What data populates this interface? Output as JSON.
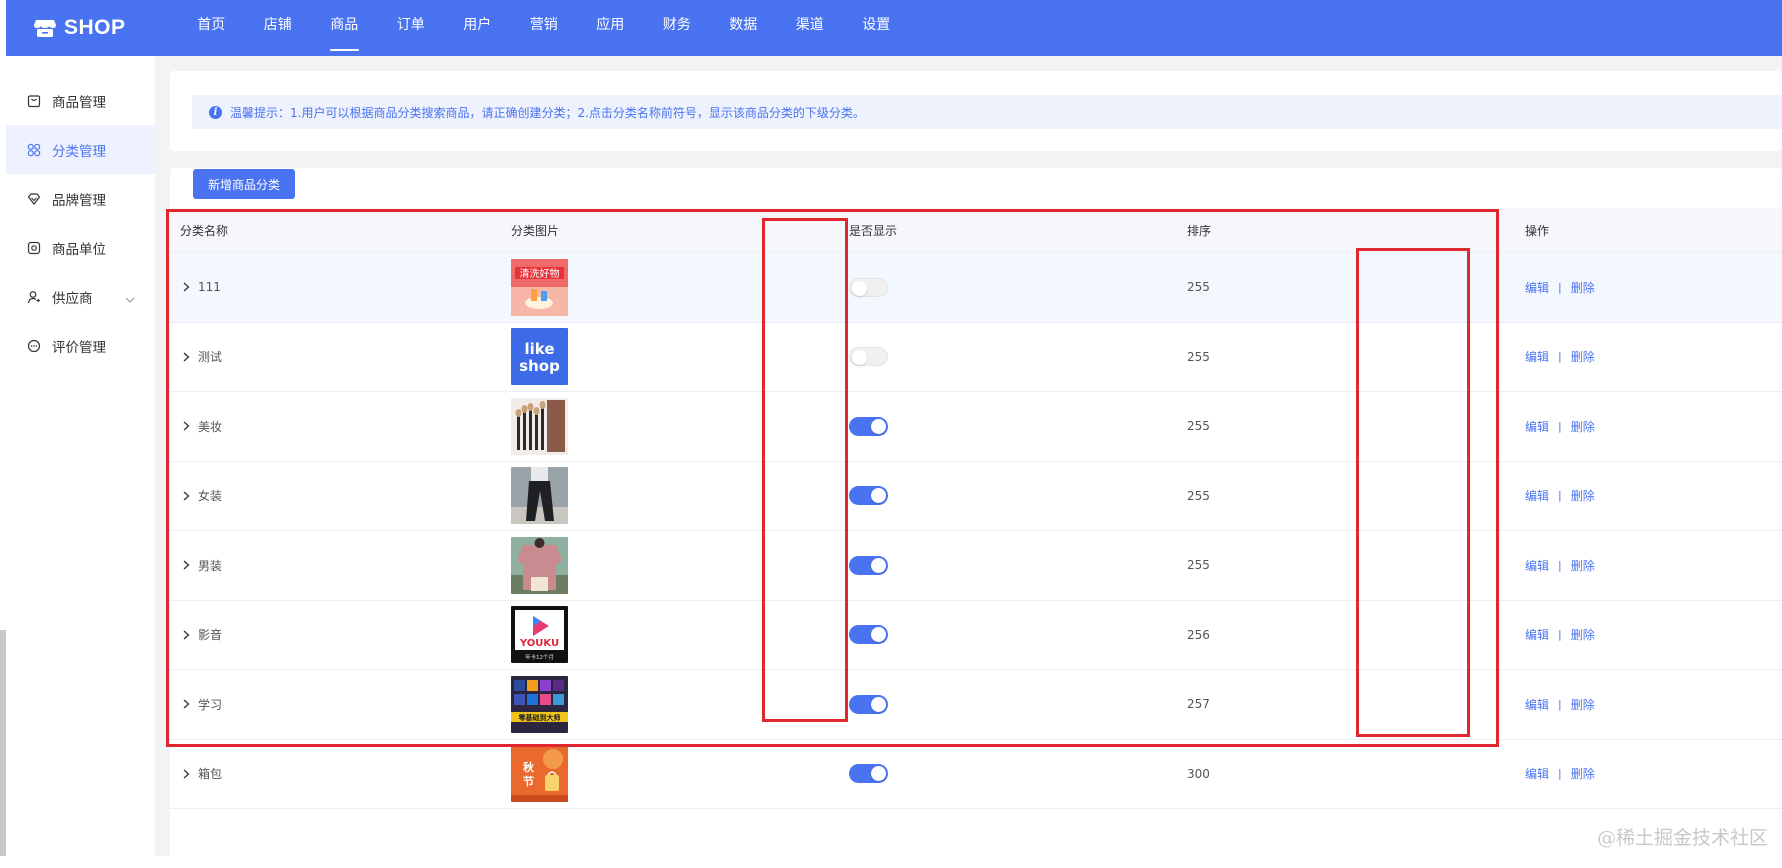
{
  "app": {
    "logo_text": "SHOP"
  },
  "topnav": {
    "items": [
      "首页",
      "店铺",
      "商品",
      "订单",
      "用户",
      "营销",
      "应用",
      "财务",
      "数据",
      "渠道",
      "设置"
    ],
    "active_index": 2
  },
  "sidebar": {
    "items": [
      {
        "label": "商品管理",
        "icon": "bag-icon"
      },
      {
        "label": "分类管理",
        "icon": "category-grid-icon",
        "active": true
      },
      {
        "label": "品牌管理",
        "icon": "diamond-icon"
      },
      {
        "label": "商品单位",
        "icon": "unit-icon"
      },
      {
        "label": "供应商",
        "icon": "supplier-user-icon",
        "expandable": true
      },
      {
        "label": "评价管理",
        "icon": "comment-icon"
      }
    ]
  },
  "tip": {
    "text": "温馨提示：1.用户可以根据商品分类搜索商品，请正确创建分类；2.点击分类名称前符号，显示该商品分类的下级分类。"
  },
  "toolbar": {
    "add_label": "新增商品分类"
  },
  "table": {
    "headers": {
      "name": "分类名称",
      "image": "分类图片",
      "show": "是否显示",
      "sort": "排序",
      "ops": "操作"
    },
    "edit_label": "编辑",
    "delete_label": "删除",
    "separator": "|",
    "rows": [
      {
        "name": "111",
        "image": "thumb-red-promo",
        "show": false,
        "sort": "255"
      },
      {
        "name": "测试",
        "image": "thumb-likeshop-logo",
        "show": false,
        "sort": "255"
      },
      {
        "name": "美妆",
        "image": "thumb-makeup-brushes",
        "show": true,
        "sort": "255"
      },
      {
        "name": "女装",
        "image": "thumb-women-pants",
        "show": true,
        "sort": "255"
      },
      {
        "name": "男装",
        "image": "thumb-men-shirt",
        "show": true,
        "sort": "255"
      },
      {
        "name": "影音",
        "image": "thumb-youku",
        "show": true,
        "sort": "256"
      },
      {
        "name": "学习",
        "image": "thumb-software-icons",
        "show": true,
        "sort": "257"
      },
      {
        "name": "箱包",
        "image": "thumb-orange-bags",
        "show": true,
        "sort": "300"
      }
    ]
  },
  "colors": {
    "primary": "#4a73f2",
    "annotation_red": "#e0262e"
  },
  "watermark": "@稀土掘金技术社区"
}
